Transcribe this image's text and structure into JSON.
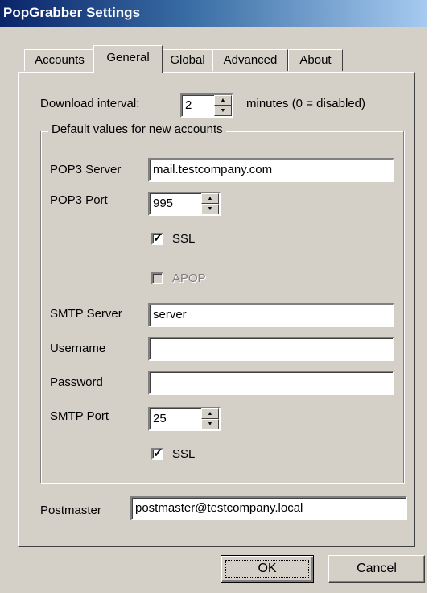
{
  "window": {
    "title": "PopGrabber Settings"
  },
  "tabs": [
    {
      "label": "Accounts",
      "active": false
    },
    {
      "label": "General",
      "active": true
    },
    {
      "label": "Global",
      "active": false
    },
    {
      "label": "Advanced",
      "active": false
    },
    {
      "label": "About",
      "active": false
    }
  ],
  "general": {
    "download_interval_label": "Download interval:",
    "download_interval_value": "2",
    "download_interval_suffix": "minutes (0 = disabled)",
    "group_title": "Default values for new accounts",
    "pop3_server_label": "POP3 Server",
    "pop3_server_value": "mail.testcompany.com",
    "pop3_port_label": "POP3 Port",
    "pop3_port_value": "995",
    "pop3_ssl_label": "SSL",
    "pop3_ssl_checked": true,
    "apop_label": "APOP",
    "apop_enabled": false,
    "smtp_server_label": "SMTP Server",
    "smtp_server_value": "server",
    "username_label": "Username",
    "username_value": "",
    "password_label": "Password",
    "password_value": "",
    "smtp_port_label": "SMTP Port",
    "smtp_port_value": "25",
    "smtp_ssl_label": "SSL",
    "smtp_ssl_checked": true,
    "postmaster_label": "Postmaster",
    "postmaster_value": "postmaster@testcompany.local"
  },
  "buttons": {
    "ok": "OK",
    "cancel": "Cancel"
  }
}
